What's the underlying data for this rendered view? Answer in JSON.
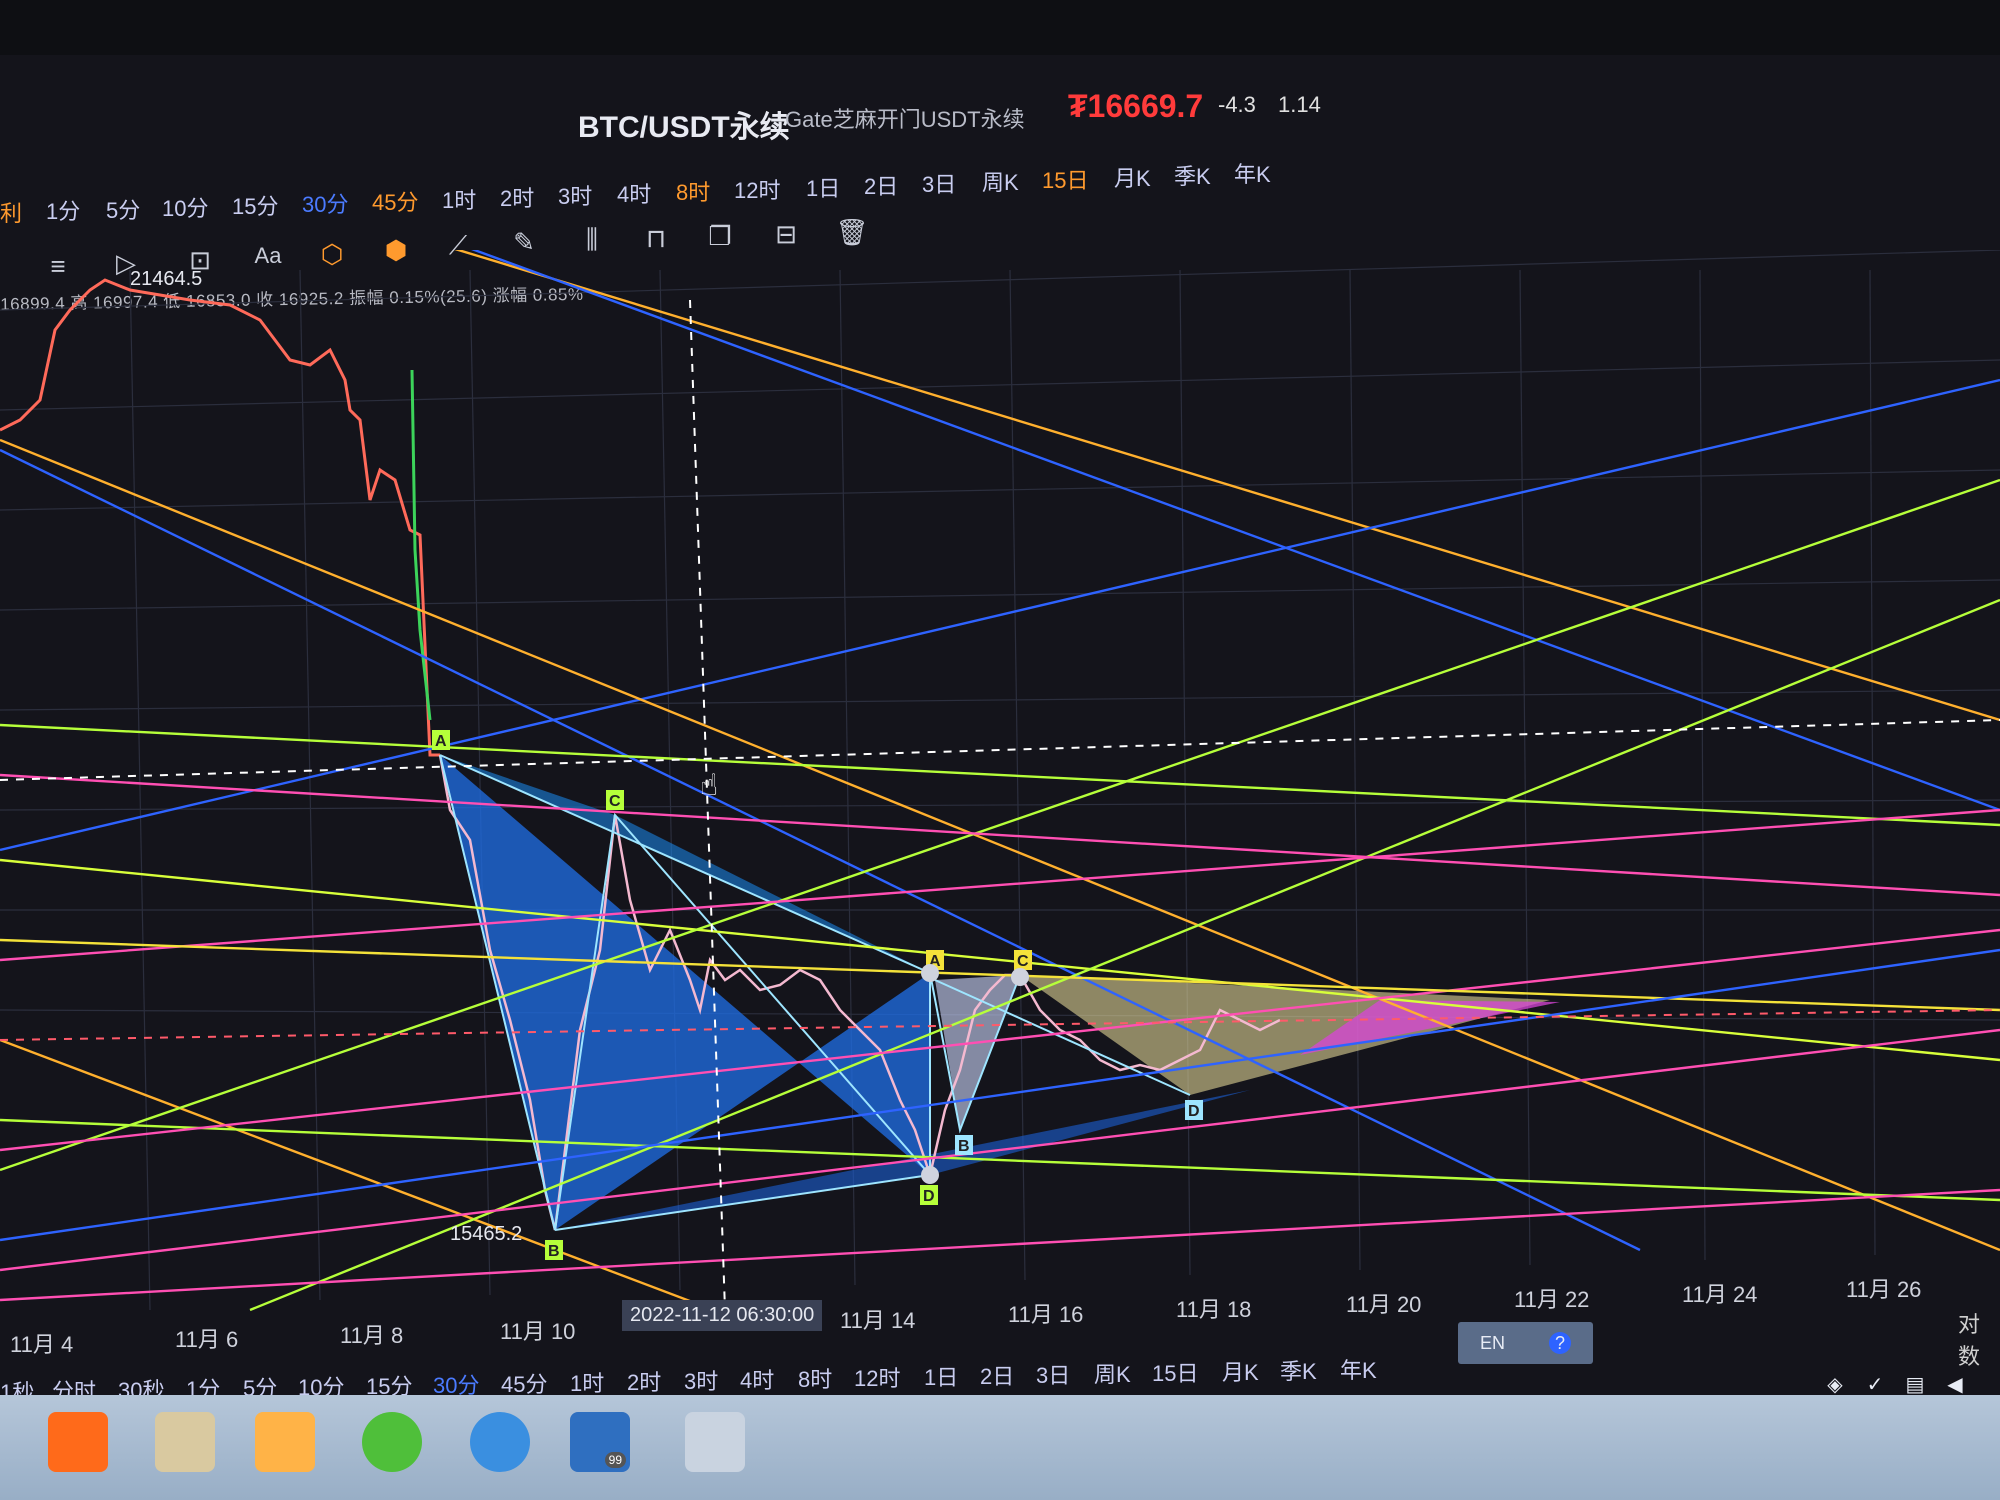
{
  "header": {
    "symbol": "BTC/USDT永续",
    "exchange": "Gate芝麻开门USDT永续",
    "price_icon": "₮",
    "last_price": "16669.7",
    "change": "-4.3",
    "change_pct": "1.14"
  },
  "intervals_top": [
    "1分",
    "5分",
    "10分",
    "15分",
    "30分",
    "45分",
    "1时",
    "2时",
    "3时",
    "4时",
    "8时",
    "12时",
    "1日",
    "2日",
    "3日",
    "周K",
    "15日",
    "月K",
    "季K",
    "年K"
  ],
  "interval_left_fragment": "利",
  "toolbar": {
    "icons": [
      "menu-icon",
      "cursor-icon",
      "rectangle-icon",
      "text-icon",
      "pattern-icon",
      "abcd-icon",
      "ruler-icon",
      "brush-icon",
      "bars-icon",
      "lock-icon",
      "copy-icon",
      "clear-icon",
      "trash-icon"
    ],
    "text_label": "Aa"
  },
  "ohlc_line": "16899.4 高 16997.4 低 16853.0 收 16925.2 振幅 0.15%(25.6) 涨幅 0.85%",
  "chart": {
    "high_label": "21464.5",
    "low_label": "15465.2",
    "crosshair_time": "2022-11-12 06:30:00",
    "axis_type": "对数",
    "xticks": [
      "11月 4",
      "11月 6",
      "11月 8",
      "11月 10",
      "11月 14",
      "11月 16",
      "11月 18",
      "11月 20",
      "11月 22",
      "11月 24",
      "11月 26"
    ],
    "pattern_points_1": [
      "A",
      "B",
      "C",
      "D"
    ],
    "pattern_points_2": [
      "A",
      "B",
      "C",
      "D"
    ],
    "colors": {
      "yellow": "#f4c430",
      "blue": "#2e63ff",
      "green": "#b6ff3a",
      "pink": "#ff4fb3",
      "orange": "#ffb02e",
      "pattern_fill": "#1f6fe8"
    }
  },
  "intervals_bottom": [
    "1秒",
    "分时",
    "30秒",
    "1分",
    "5分",
    "10分",
    "15分",
    "30分",
    "45分",
    "1时",
    "2时",
    "3时",
    "4时",
    "8时",
    "12时",
    "1日",
    "2日",
    "3日",
    "周K",
    "15日",
    "月K",
    "季K",
    "年K"
  ],
  "ime": {
    "lang": "EN",
    "help": "?"
  },
  "taskbar": {
    "apps": [
      "taobao-app",
      "folder-app",
      "media-app",
      "browser-360-app",
      "ie-browser-app",
      "trading-app",
      "calculator-app"
    ],
    "badge": "99"
  }
}
